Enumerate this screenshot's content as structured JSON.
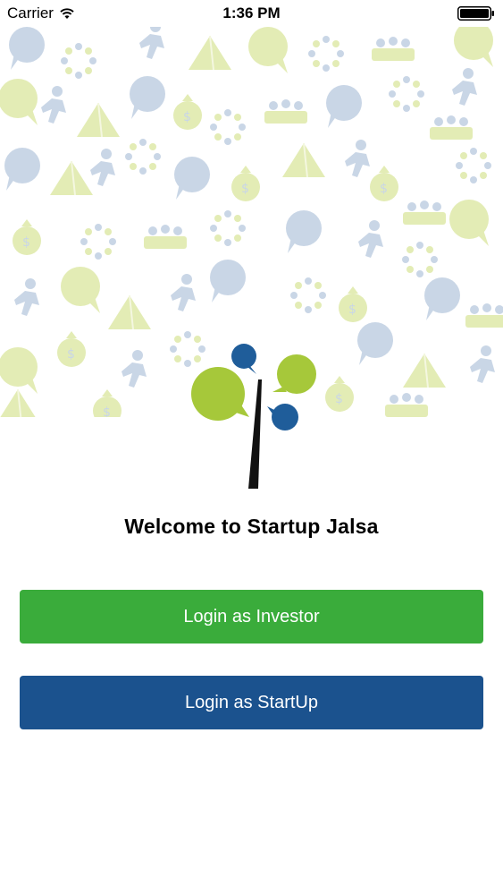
{
  "status_bar": {
    "carrier": "Carrier",
    "time": "1:36 PM",
    "icons": [
      "wifi-icon",
      "battery-icon"
    ]
  },
  "welcome": {
    "title": "Welcome to Startup Jalsa"
  },
  "buttons": {
    "investor_label": "Login as Investor",
    "startup_label": "Login as StartUp"
  },
  "colors": {
    "investor_green": "#3aac3b",
    "startup_blue": "#1b528e",
    "logo_green": "#a6c83a",
    "logo_blue": "#1f5d9a",
    "pattern_green": "#e3ecb5",
    "pattern_blue": "#c9d6e6"
  }
}
